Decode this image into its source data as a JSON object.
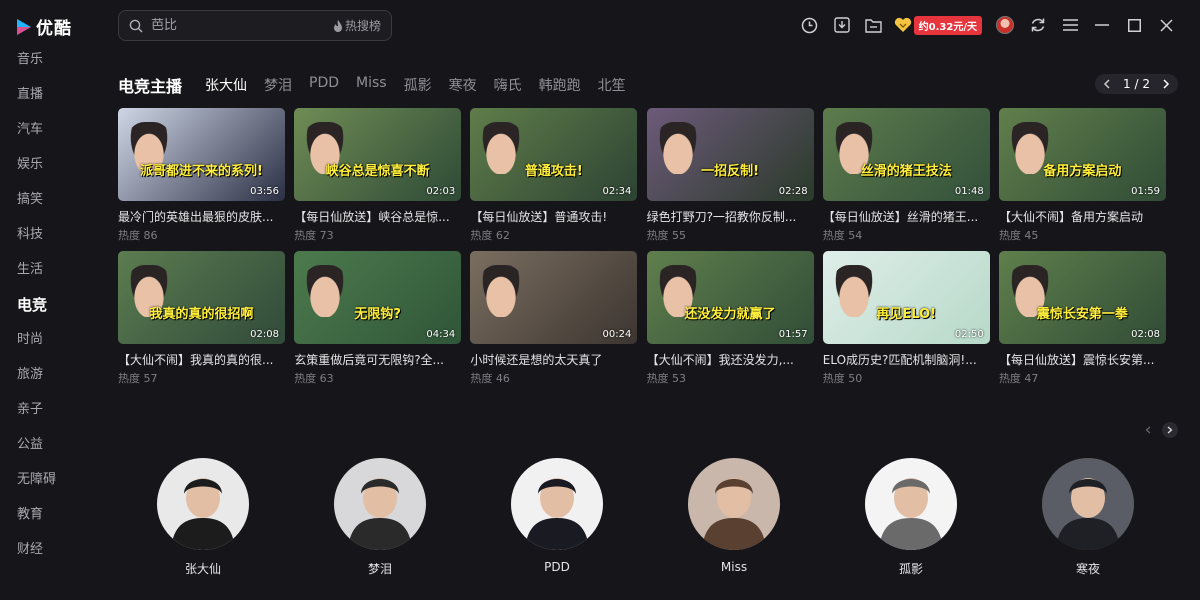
{
  "app": {
    "logo_text": "优酷"
  },
  "sidebar": {
    "items": [
      {
        "label": "音乐"
      },
      {
        "label": "直播"
      },
      {
        "label": "汽车"
      },
      {
        "label": "娱乐"
      },
      {
        "label": "搞笑"
      },
      {
        "label": "科技"
      },
      {
        "label": "生活"
      },
      {
        "label": "电竞",
        "active": true
      },
      {
        "label": "时尚"
      },
      {
        "label": "旅游"
      },
      {
        "label": "亲子"
      },
      {
        "label": "公益"
      },
      {
        "label": "无障碍"
      },
      {
        "label": "教育"
      },
      {
        "label": "财经"
      }
    ]
  },
  "search": {
    "value": "",
    "placeholder": "芭比",
    "hot_label": "热搜榜"
  },
  "topbar": {
    "vip_badge": "约0.32元/天"
  },
  "section": {
    "title": "电竞主播",
    "tabs": [
      "张大仙",
      "梦泪",
      "PDD",
      "Miss",
      "孤影",
      "寒夜",
      "嗨氏",
      "韩跑跑",
      "北笙"
    ],
    "active_tab": 0,
    "pager": "1 / 2"
  },
  "videos": [
    {
      "title": "最冷门的英雄出最狠的皮肤...",
      "heat": "热度 86",
      "duration": "03:56",
      "caption": "派哥都进不来的系列!",
      "bg": [
        "#cfd7e6",
        "#2b2f44"
      ]
    },
    {
      "title": "【每日仙放送】峡谷总是惊...",
      "heat": "热度 73",
      "duration": "02:03",
      "caption": "峡谷总是惊喜不断",
      "bg": [
        "#6f8c55",
        "#2e4a36"
      ]
    },
    {
      "title": "【每日仙放送】普通攻击!",
      "heat": "热度 62",
      "duration": "02:34",
      "caption": "普通攻击!",
      "bg": [
        "#5f7d4a",
        "#2d4333"
      ]
    },
    {
      "title": "绿色打野刀?一招教你反制...",
      "heat": "热度 55",
      "duration": "02:28",
      "caption": "一招反制!",
      "bg": [
        "#6d5a7a",
        "#2a3a2a"
      ]
    },
    {
      "title": "【每日仙放送】丝滑的猪王...",
      "heat": "热度 54",
      "duration": "01:48",
      "caption": "丝滑的猪王技法",
      "bg": [
        "#5d7c4d",
        "#32503a"
      ]
    },
    {
      "title": "【大仙不闹】备用方案启动",
      "heat": "热度 45",
      "duration": "01:59",
      "caption": "备用方案启动",
      "bg": [
        "#617f4c",
        "#304c36"
      ]
    },
    {
      "title": "【大仙不闹】我真的真的很...",
      "heat": "热度 57",
      "duration": "02:08",
      "caption": "我真的真的很招啊",
      "bg": [
        "#5b7d50",
        "#314a3a"
      ]
    },
    {
      "title": "玄策重做后竟可无限钩?全...",
      "heat": "热度 63",
      "duration": "04:34",
      "caption": "无限钩?",
      "bg": [
        "#4d7a4d",
        "#2f5638"
      ]
    },
    {
      "title": "小时候还是想的太天真了",
      "heat": "热度 46",
      "duration": "00:24",
      "caption": "",
      "bg": [
        "#7a6e60",
        "#3c3530"
      ]
    },
    {
      "title": "【大仙不闹】我还没发力,...",
      "heat": "热度 53",
      "duration": "01:57",
      "caption": "还没发力就赢了",
      "bg": [
        "#607f4d",
        "#314d37"
      ]
    },
    {
      "title": "ELO成历史?匹配机制脑洞!...",
      "heat": "热度 50",
      "duration": "02:50",
      "caption": "再见ELO!",
      "bg": [
        "#dfeee9",
        "#b7d9c9"
      ]
    },
    {
      "title": "【每日仙放送】震惊长安第...",
      "heat": "热度 47",
      "duration": "02:08",
      "caption": "震惊长安第一拳",
      "bg": [
        "#5f7f4c",
        "#314c36"
      ]
    }
  ],
  "streamers": [
    {
      "name": "张大仙",
      "bg": "#e9e9ea",
      "fg": "#1c1c1c"
    },
    {
      "name": "梦泪",
      "bg": "#d8d8da",
      "fg": "#2a2a2a"
    },
    {
      "name": "PDD",
      "bg": "#f1f1f2",
      "fg": "#1a1a22"
    },
    {
      "name": "Miss",
      "bg": "#c9b7ab",
      "fg": "#5a4030"
    },
    {
      "name": "孤影",
      "bg": "#f4f4f4",
      "fg": "#6a6a6a"
    },
    {
      "name": "寒夜",
      "bg": "#5a5d66",
      "fg": "#1f2026"
    }
  ]
}
